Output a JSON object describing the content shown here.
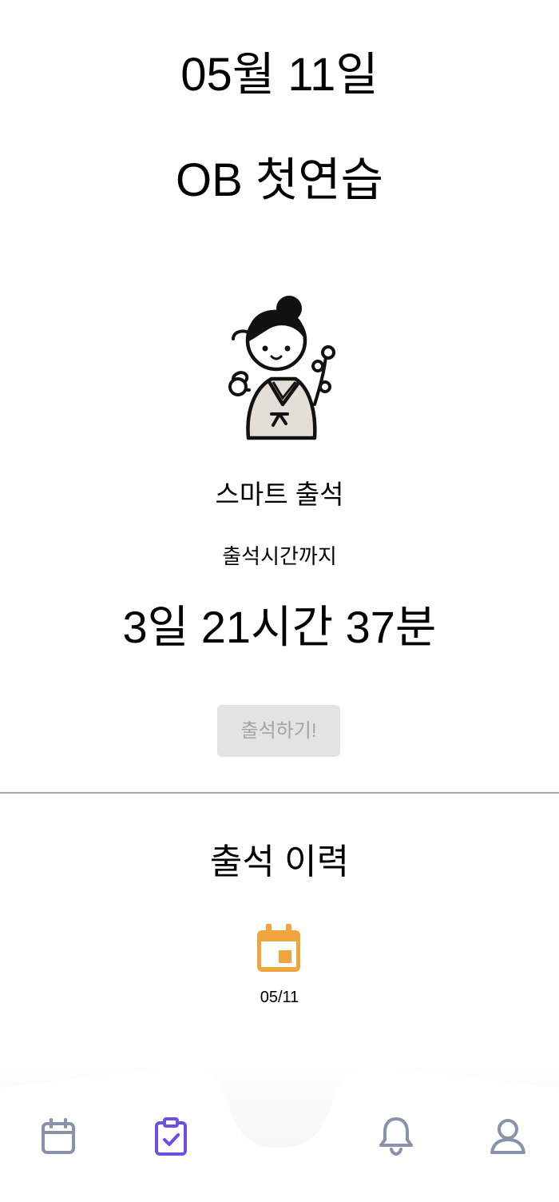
{
  "header": {
    "date": "05월 11일",
    "event_title": "OB 첫연습"
  },
  "attendance": {
    "title": "스마트 출석",
    "countdown_label": "출석시간까지",
    "countdown": "3일 21시간 37분",
    "button_label": "출석하기!"
  },
  "history": {
    "title": "출석 이력",
    "items": [
      {
        "date": "05/11",
        "icon": "calendar-event-icon"
      }
    ]
  },
  "bottom_nav": {
    "items": [
      {
        "icon": "calendar-icon",
        "active": false
      },
      {
        "icon": "clipboard-check-icon",
        "active": true
      },
      {
        "icon": "bell-icon",
        "active": false
      },
      {
        "icon": "user-icon",
        "active": false
      }
    ]
  },
  "colors": {
    "accent": "#6e4fe0",
    "inactive_icon": "#8992a8",
    "history_icon": "#f0a53f",
    "button_bg": "#e3e3e3",
    "button_text": "#a4a4a4"
  }
}
